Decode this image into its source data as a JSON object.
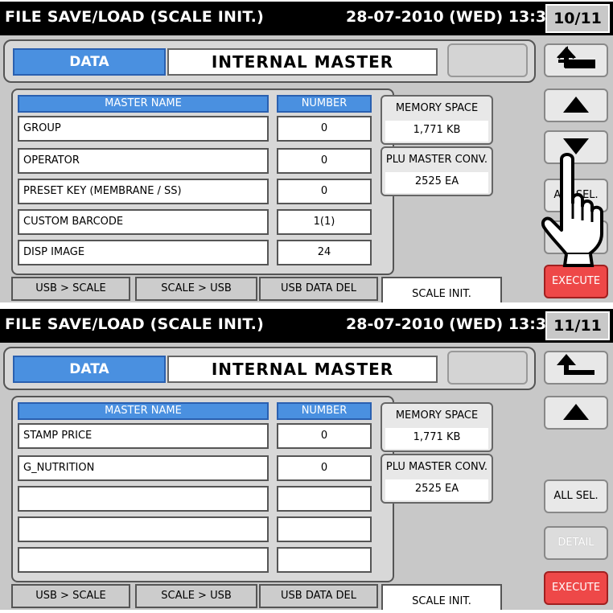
{
  "screens": [
    {
      "title": "FILE SAVE/LOAD (SCALE INIT.)",
      "datetime": "28-07-2010 (WED) 13:36",
      "page": "10/11",
      "data_label": "DATA",
      "master_label": "INTERNAL MASTER",
      "headers": {
        "name": "MASTER NAME",
        "number": "NUMBER"
      },
      "rows": [
        {
          "name": "GROUP",
          "number": "0"
        },
        {
          "name": "OPERATOR",
          "number": "0"
        },
        {
          "name": "PRESET KEY (MEMBRANE / SS)",
          "number": "0"
        },
        {
          "name": "CUSTOM BARCODE",
          "number": "1(1)"
        },
        {
          "name": "DISP IMAGE",
          "number": "24"
        }
      ],
      "memory_space": {
        "label": "MEMORY SPACE",
        "value": "1,771 KB"
      },
      "plu_conv": {
        "label": "PLU MASTER CONV.",
        "value": "2525 EA"
      },
      "tabs": [
        "USB > SCALE",
        "SCALE > USB",
        "USB DATA DEL",
        "SCALE INIT."
      ],
      "side": {
        "all_sel": "ALL SEL.",
        "detail": "DETAIL",
        "execute": "EXECUTE"
      }
    },
    {
      "title": "FILE SAVE/LOAD (SCALE INIT.)",
      "datetime": "28-07-2010 (WED) 13:36",
      "page": "11/11",
      "data_label": "DATA",
      "master_label": "INTERNAL MASTER",
      "headers": {
        "name": "MASTER NAME",
        "number": "NUMBER"
      },
      "rows": [
        {
          "name": "STAMP PRICE",
          "number": "0"
        },
        {
          "name": "G_NUTRITION",
          "number": "0"
        },
        {
          "name": "",
          "number": ""
        },
        {
          "name": "",
          "number": ""
        },
        {
          "name": "",
          "number": ""
        }
      ],
      "memory_space": {
        "label": "MEMORY SPACE",
        "value": "1,771 KB"
      },
      "plu_conv": {
        "label": "PLU MASTER CONV.",
        "value": "2525 EA"
      },
      "tabs": [
        "USB > SCALE",
        "SCALE > USB",
        "USB DATA DEL",
        "SCALE INIT."
      ],
      "side": {
        "all_sel": "ALL SEL.",
        "detail": "DETAIL",
        "execute": "EXECUTE"
      }
    }
  ],
  "icons": {
    "back": "back-arrow-icon",
    "up": "up-triangle-icon",
    "down": "down-triangle-icon",
    "hand": "pointing-hand-icon"
  },
  "colors": {
    "title_bar": "#000000",
    "screen_bg": "#c8c8c8",
    "header_blue": "#4a90e0",
    "execute_red": "#ee4848"
  }
}
